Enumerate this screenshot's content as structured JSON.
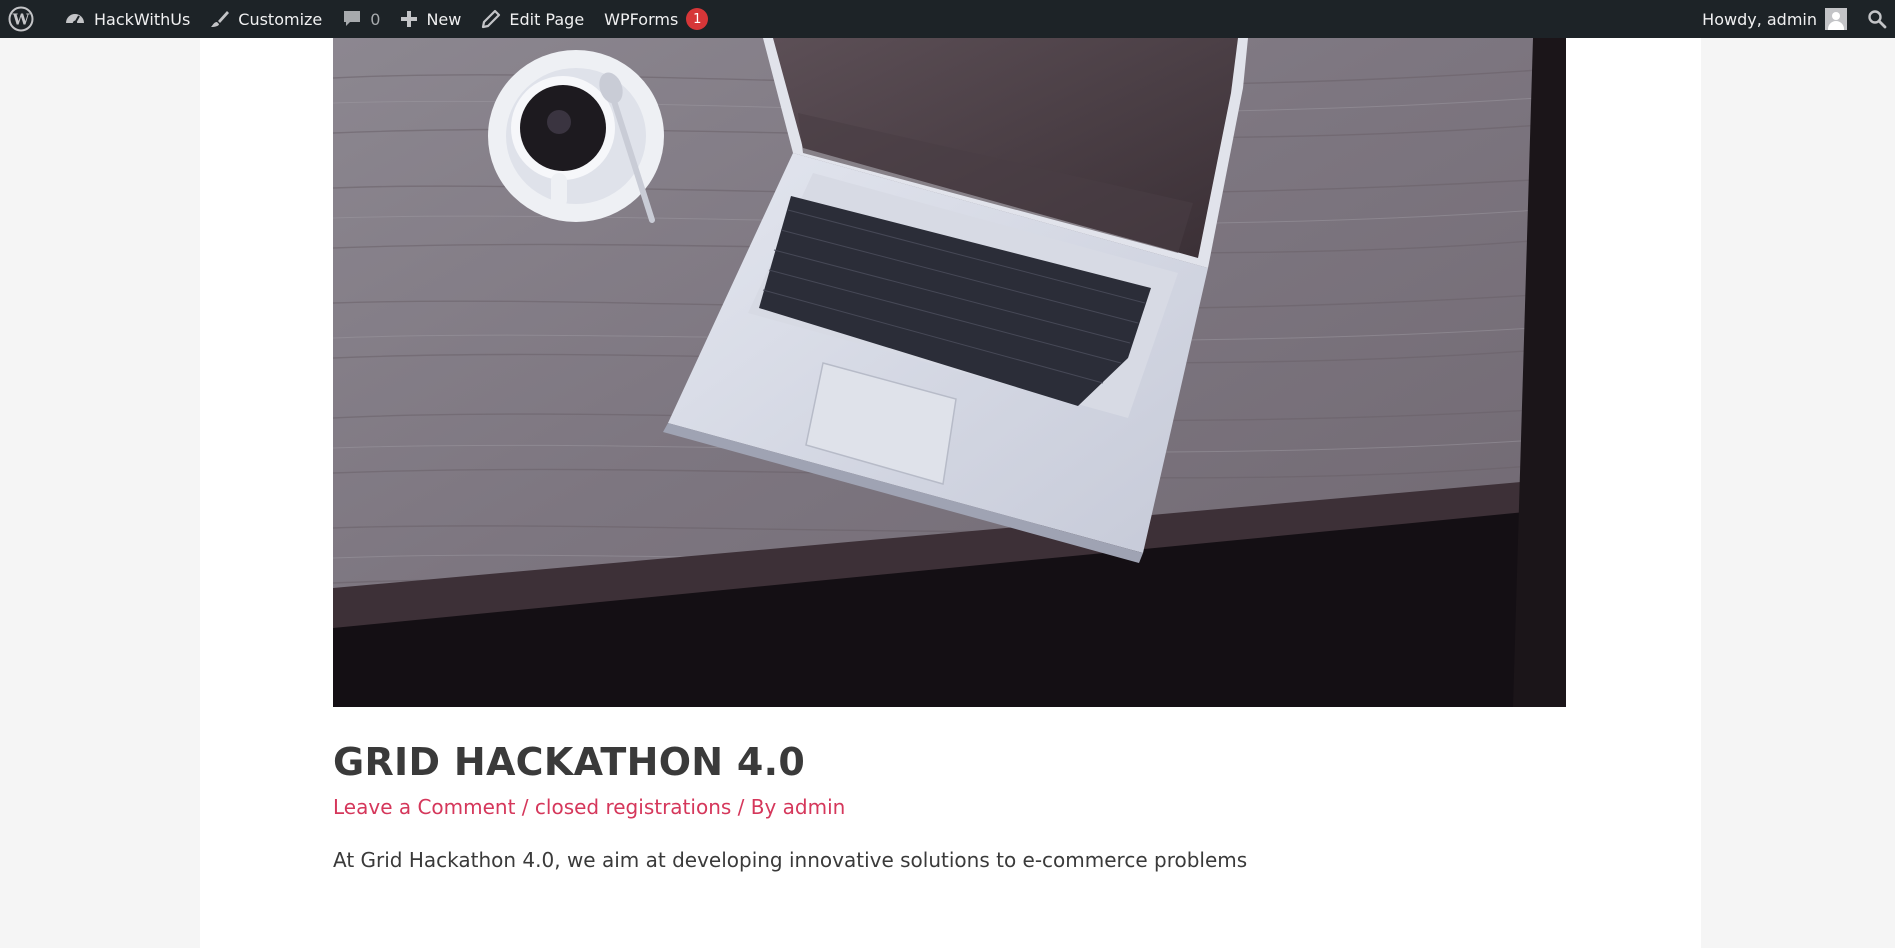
{
  "adminbar": {
    "site_name": "HackWithUs",
    "customize_label": "Customize",
    "comments_count": "0",
    "new_label": "New",
    "edit_page_label": "Edit Page",
    "wpforms_label": "WPForms",
    "wpforms_badge": "1",
    "howdy_label": "Howdy, admin",
    "icons": [
      "wordpress-logo-icon",
      "dashboard-icon",
      "paintbrush-icon",
      "comment-icon",
      "plus-icon",
      "pencil-icon",
      "user-avatar-icon",
      "search-icon"
    ]
  },
  "post": {
    "title": "GRID HACKATHON 4.0",
    "meta": {
      "leave_comment": "Leave a Comment",
      "separator": " / ",
      "category": "closed registrations",
      "by_prefix": "By ",
      "author": "admin"
    },
    "excerpt": "At Grid Hackathon 4.0, we aim at developing innovative solutions to e-commerce problems"
  },
  "colors": {
    "adminbar_bg": "#1d2327",
    "accent_link": "#d5375b",
    "title_text": "#3a3a3a",
    "badge_red": "#d63638",
    "page_bg": "#f5f5f5"
  }
}
